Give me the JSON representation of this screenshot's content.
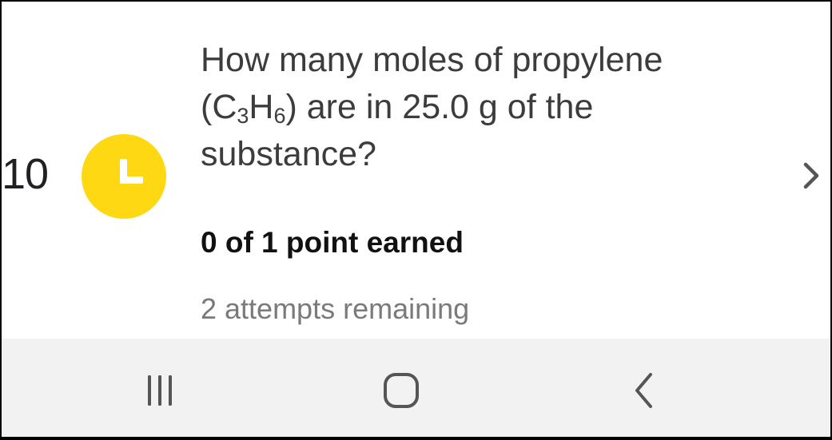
{
  "question": {
    "number": "10",
    "status_icon": "clock-icon",
    "status_color": "#FFD814",
    "text_line1": "How many moles of propylene",
    "text_paren_open": "(C",
    "text_sub1": "3",
    "text_h": "H",
    "text_sub2": "6",
    "text_line2_rest": ") are in 25.0 g of the",
    "text_line3": "substance?",
    "points_label": "0 of 1 point earned",
    "attempts_label": "2 attempts remaining",
    "open_icon": "chevron-right-icon"
  },
  "nav_bar": {
    "recents_icon": "recents-icon",
    "home_icon": "home-icon",
    "back_icon": "back-icon"
  }
}
